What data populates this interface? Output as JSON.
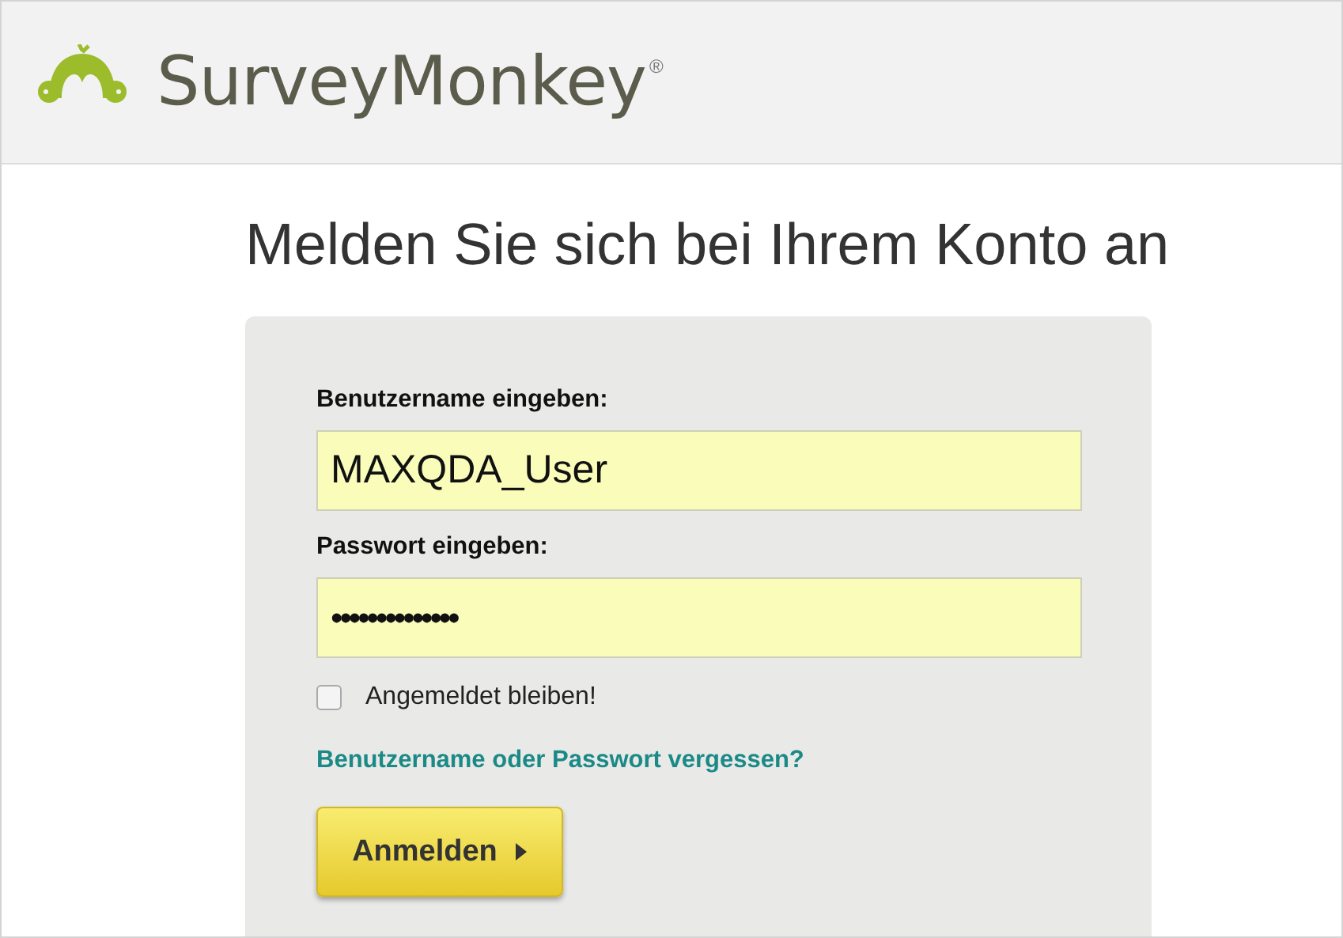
{
  "header": {
    "logo_text": "SurveyMonkey",
    "logo_mark": "®"
  },
  "title": "Melden Sie sich bei Ihrem Konto an",
  "form": {
    "username": {
      "label": "Benutzername eingeben:",
      "value": "MAXQDA_User"
    },
    "password": {
      "label": "Passwort eingeben:",
      "value": "••••••••••••••"
    },
    "remember": {
      "label": "Angemeldet bleiben!",
      "checked": false
    },
    "forgot_link": "Benutzername oder Passwort vergessen?",
    "submit": "Anmelden"
  }
}
